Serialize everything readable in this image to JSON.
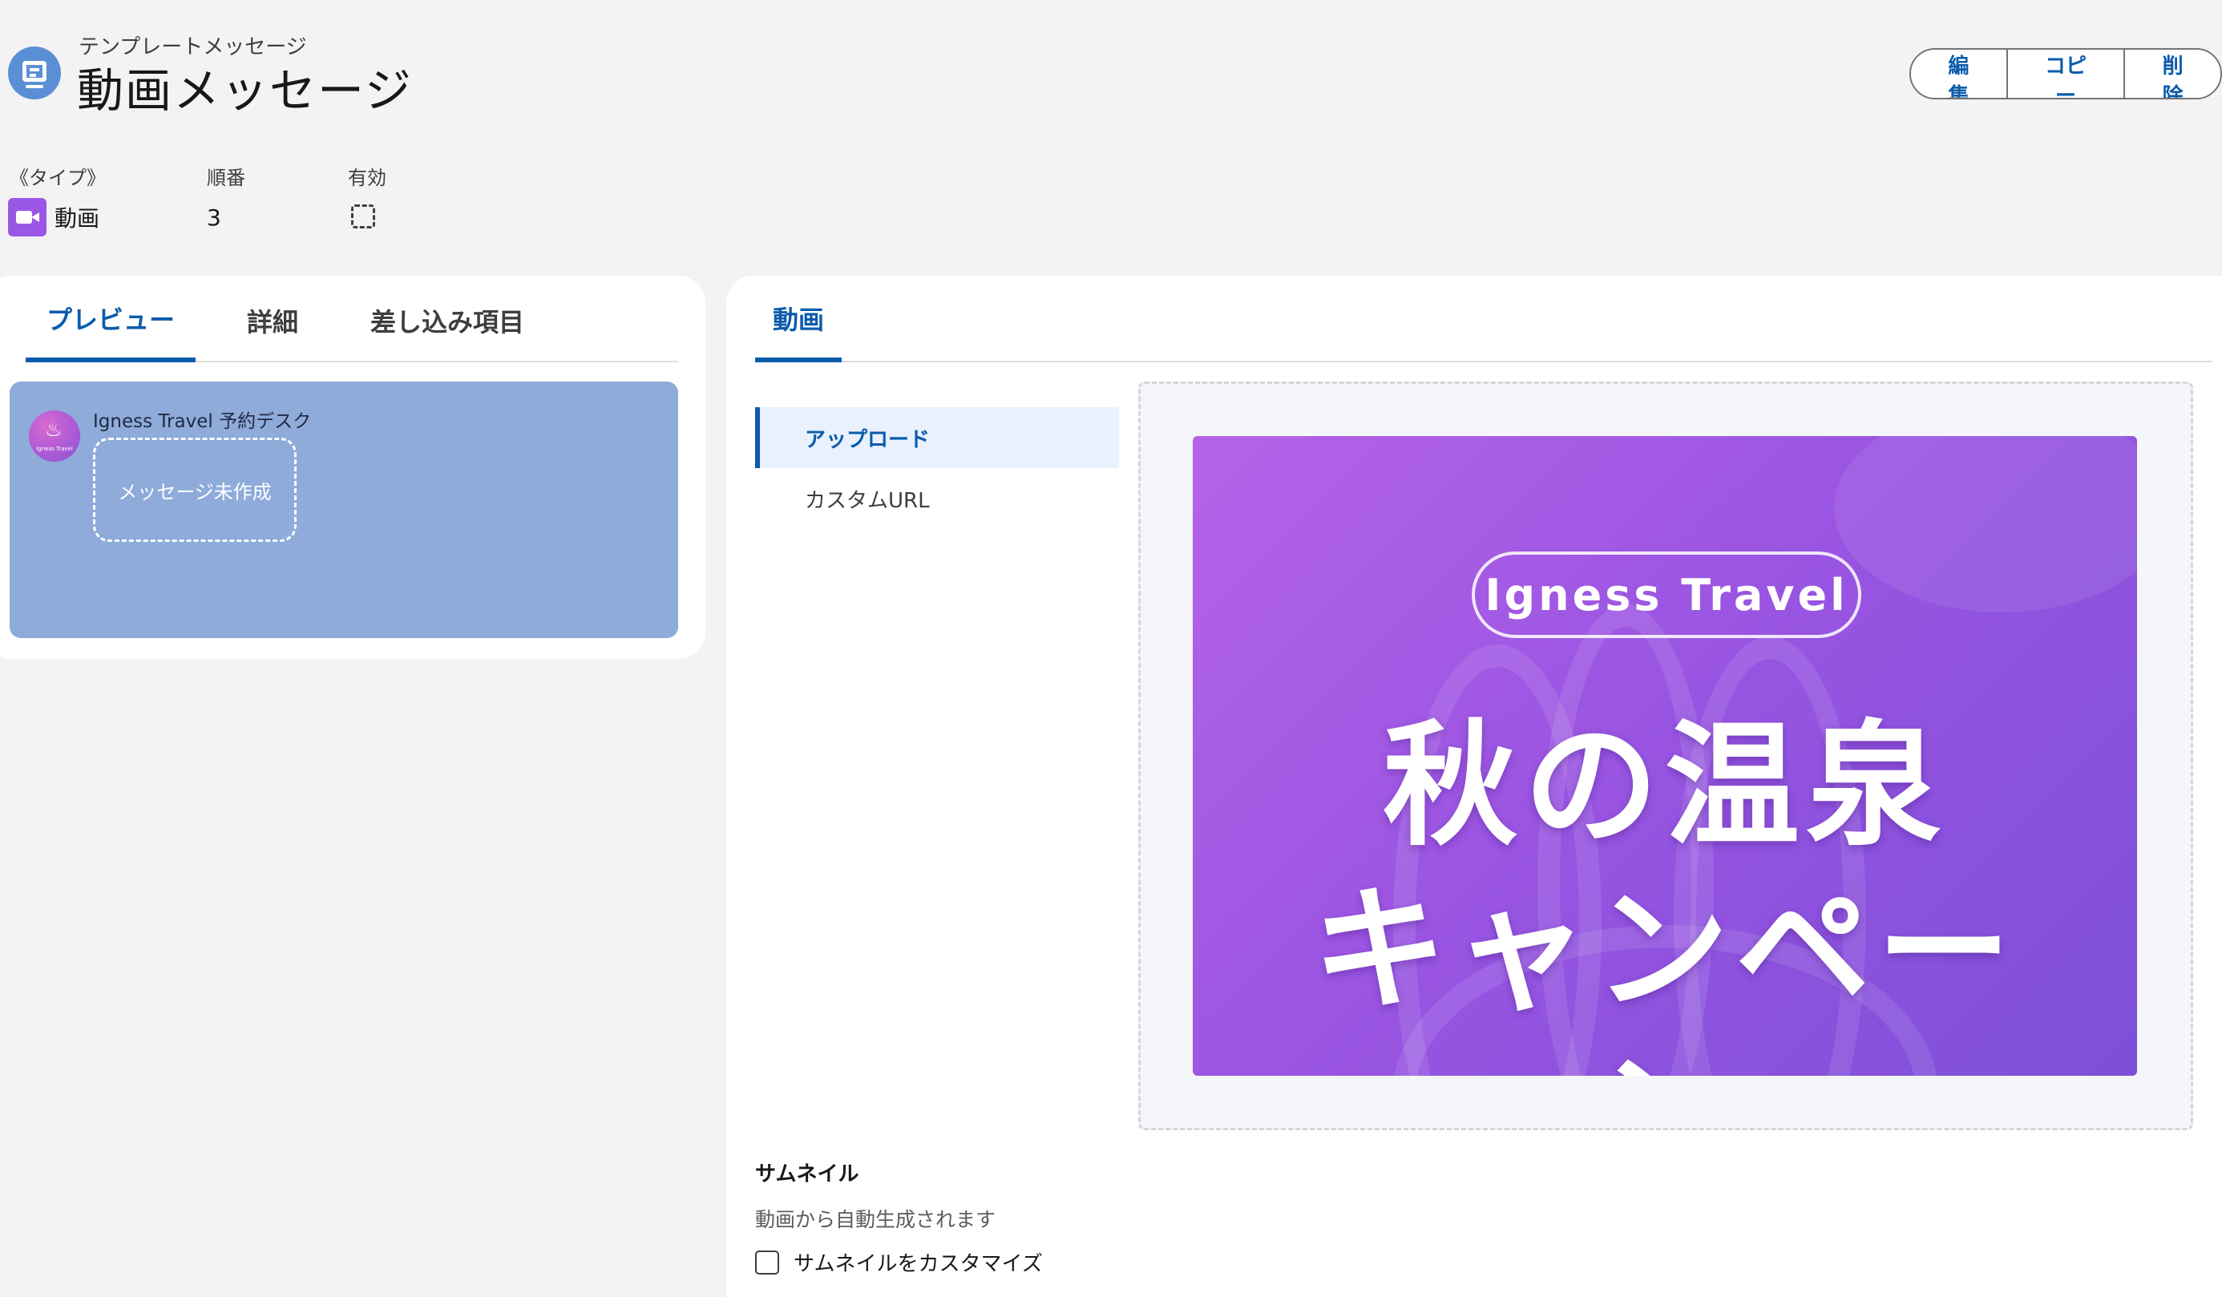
{
  "header": {
    "object_label": "テンプレートメッセージ",
    "title": "動画メッセージ",
    "actions": {
      "edit": "編集",
      "copy": "コピー",
      "delete": "削除"
    }
  },
  "highlights": {
    "type": {
      "label": "《タイプ》",
      "value": "動画"
    },
    "order": {
      "label": "順番",
      "value": "3"
    },
    "active": {
      "label": "有効"
    }
  },
  "left_tabs": [
    "プレビュー",
    "詳細",
    "差し込み項目"
  ],
  "preview": {
    "sender": "Igness Travel 予約デスク",
    "avatar_text": "Igness Travel",
    "bubble_text": "メッセージ未作成"
  },
  "right_tabs": [
    "動画"
  ],
  "video_nav": [
    "アップロード",
    "カスタムURL"
  ],
  "poster": {
    "brand": "Igness Travel",
    "headline_1": "秋の温泉",
    "headline_2": "キャンペー",
    "headline_3": "ン"
  },
  "thumbnail": {
    "title": "サムネイル",
    "help": "動画から自動生成されます",
    "customize_label": "サムネイルをカスタマイズ"
  },
  "colors": {
    "accent": "#0b5cab",
    "preview_bg": "#8eabda",
    "video_icon": "#9a57e6"
  }
}
